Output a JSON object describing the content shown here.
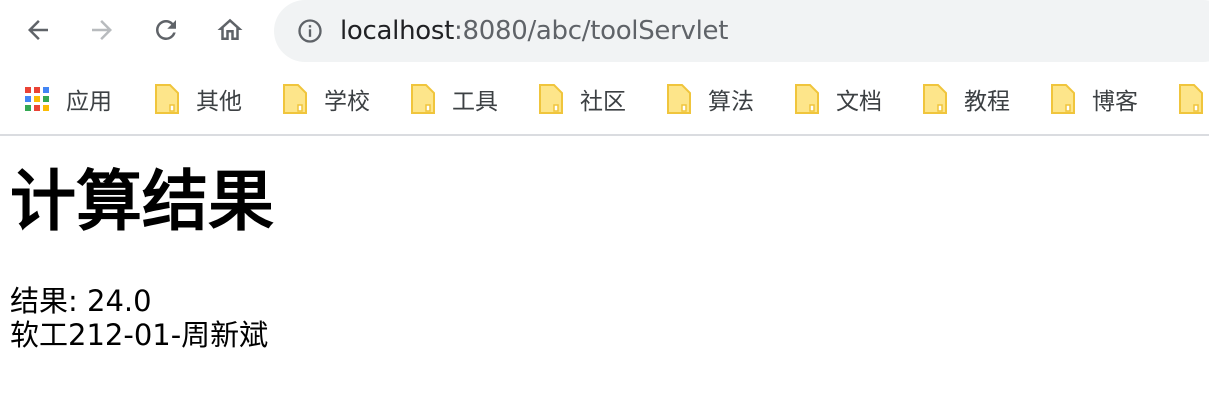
{
  "browser": {
    "url_host": "localhost",
    "url_path": ":8080/abc/toolServlet",
    "bookmarks": [
      {
        "label": "应用",
        "icon": "apps-grid-icon"
      },
      {
        "label": "其他",
        "icon": "folder-icon"
      },
      {
        "label": "学校",
        "icon": "folder-icon"
      },
      {
        "label": "工具",
        "icon": "folder-icon"
      },
      {
        "label": "社区",
        "icon": "folder-icon"
      },
      {
        "label": "算法",
        "icon": "folder-icon"
      },
      {
        "label": "文档",
        "icon": "folder-icon"
      },
      {
        "label": "教程",
        "icon": "folder-icon"
      },
      {
        "label": "博客",
        "icon": "folder-icon"
      },
      {
        "label": "",
        "icon": "folder-icon"
      }
    ],
    "colors": {
      "folder": "#fbd75b",
      "omnibox": "#f1f3f4"
    }
  },
  "page": {
    "heading": "计算结果",
    "result_line": "结果: 24.0",
    "author_line": "软工212-01-周新斌"
  }
}
